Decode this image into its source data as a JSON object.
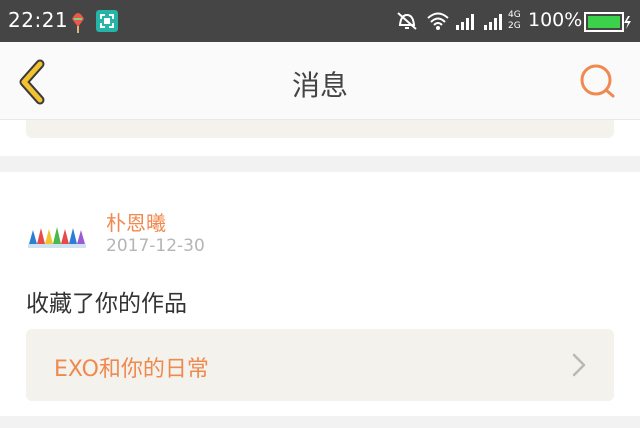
{
  "status_bar": {
    "time": "22:21",
    "battery": "100%",
    "network_labels": [
      "4G",
      "2G"
    ],
    "icons": [
      "popsicle-icon",
      "screenshot-icon",
      "mute-icon",
      "wifi-icon",
      "signal-icon",
      "signal-dual-icon",
      "battery-icon"
    ]
  },
  "header": {
    "title": "消息",
    "back_icon": "chevron-left-icon",
    "search_icon": "search-icon",
    "accent_color": "#f0894f"
  },
  "message": {
    "username": "朴恩曦",
    "date": "2017-12-30",
    "text": "收藏了你的作品",
    "work_title": "EXO和你的日常",
    "link_icon": "chevron-right-icon"
  }
}
